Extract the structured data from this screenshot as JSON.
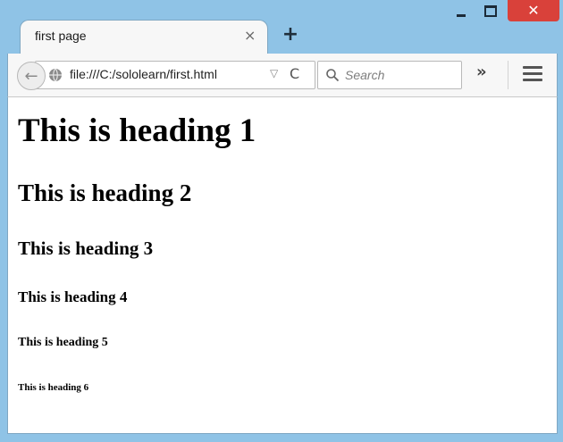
{
  "window": {
    "controls": {
      "minimize_icon": "minimize-icon",
      "maximize_icon": "maximize-icon",
      "close_glyph": "✕"
    },
    "accent_color": "#8fc3e6",
    "close_color": "#d9413a"
  },
  "tab": {
    "title": "first page",
    "close_glyph": "×",
    "new_tab_glyph": "+"
  },
  "toolbar": {
    "back_glyph": "←",
    "url": "file:///C:/sololearn/first.html",
    "dropmarker_glyph": "▽",
    "reload_glyph": "C",
    "search_placeholder": "Search",
    "overflow_glyph": "»"
  },
  "page": {
    "h1": "This is heading 1",
    "h2": "This is heading 2",
    "h3": "This is heading 3",
    "h4": "This is heading 4",
    "h5": "This is heading 5",
    "h6": "This is heading 6"
  }
}
